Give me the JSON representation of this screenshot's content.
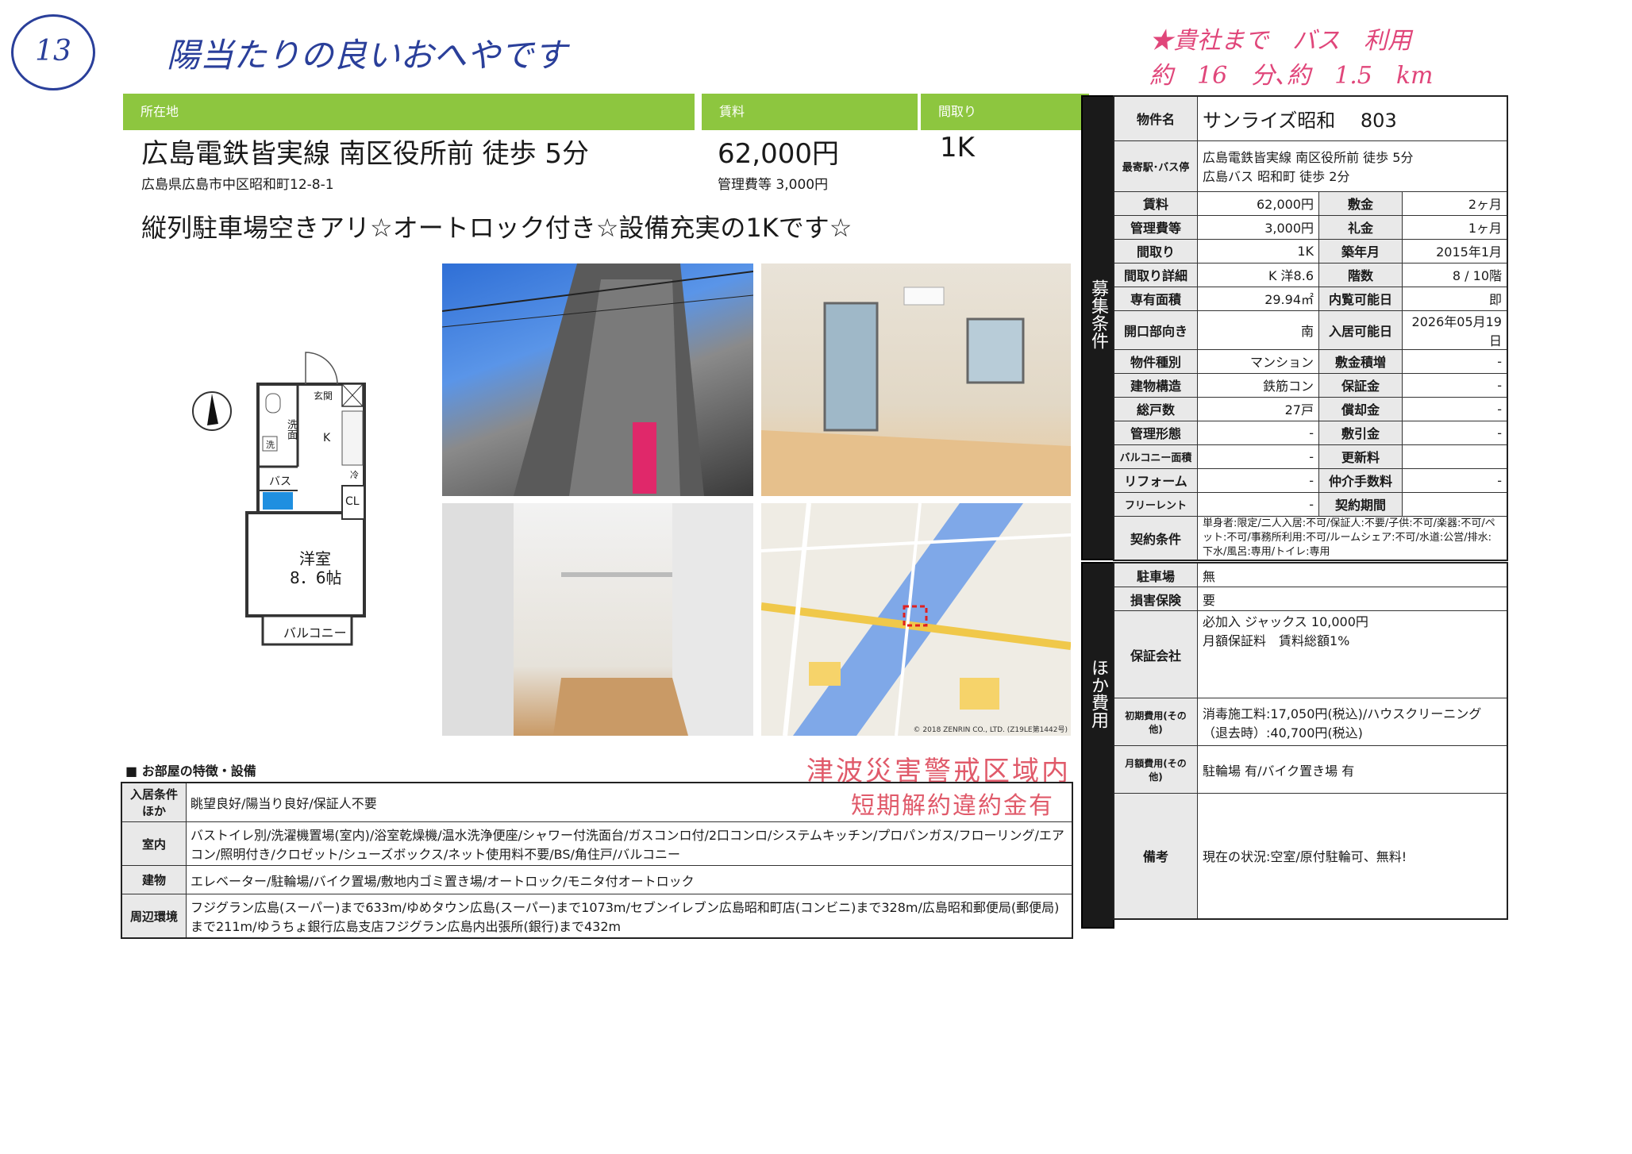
{
  "handwritten": {
    "circle_number": "13",
    "note_left": "陽当たりの良いおへやです",
    "note_right_line1": "★貴社まで　バス　利用",
    "note_right_line2": "約　16　分､約　1.5　km"
  },
  "header": {
    "location_label": "所在地",
    "rent_label": "賃料",
    "layout_label": "間取り",
    "access": "広島電鉄皆実線 南区役所前 徒歩 5分",
    "address": "広島県広島市中区昭和町12-8-1",
    "rent": "62,000円",
    "mgmt_fee": "管理費等 3,000円",
    "layout": "1K",
    "catchcopy": "縦列駐車場空きアリ☆オートロック付き☆設備充実の1Kです☆"
  },
  "floorplan": {
    "entrance": "玄関",
    "washroom": "洗面",
    "laundry": "洗",
    "kitchen": "K",
    "fridge": "冷",
    "bath": "バス",
    "closet": "CL",
    "room": "洋室",
    "room_size": "8．6帖",
    "balcony": "バルコニー"
  },
  "photos": {
    "map_copyright": "© 2018 ZENRIN CO., LTD. (Z19LE第1442号)"
  },
  "stamps": {
    "tsunami": "津波災害警戒区域内",
    "penalty": "短期解約違約金有"
  },
  "features": {
    "title": "■ お部屋の特徴・設備",
    "rows": [
      {
        "label": "入居条件ほか",
        "text": "眺望良好/陽当り良好/保証人不要"
      },
      {
        "label": "室内",
        "text": "バストイレ別/洗濯機置場(室内)/浴室乾燥機/温水洗浄便座/シャワー付洗面台/ガスコンロ付/2口コンロ/システムキッチン/プロパンガス/フローリング/エアコン/照明付き/クロゼット/シューズボックス/ネット使用料不要/BS/角住戸/バルコニー"
      },
      {
        "label": "建物",
        "text": "エレベーター/駐輪場/バイク置場/敷地内ゴミ置き場/オートロック/モニタ付オートロック"
      },
      {
        "label": "周辺環境",
        "text": "フジグラン広島(スーパー)まで633m/ゆめタウン広島(スーパー)まで1073m/セブンイレブン広島昭和町店(コンビニ)まで328m/広島昭和郵便局(郵便局)まで211m/ゆうちょ銀行広島支店フジグラン広島内出張所(銀行)まで432m"
      }
    ]
  },
  "spec": {
    "side_label_1": "募集条件",
    "side_label_2": "ほか費用",
    "name_label": "物件名",
    "name": "サンライズ昭和　 803",
    "station_label": "最寄駅･バス停",
    "station_1": "広島電鉄皆実線 南区役所前 徒歩 5分",
    "station_2": "広島バス 昭和町 徒歩 2分",
    "rows": [
      {
        "l1": "賃料",
        "v1": "62,000円",
        "l2": "敷金",
        "v2": "2ヶ月"
      },
      {
        "l1": "管理費等",
        "v1": "3,000円",
        "l2": "礼金",
        "v2": "1ヶ月"
      },
      {
        "l1": "間取り",
        "v1": "1K",
        "l2": "築年月",
        "v2": "2015年1月"
      },
      {
        "l1": "間取り詳細",
        "v1": "K 洋8.6",
        "l2": "階数",
        "v2": "8 / 10階"
      },
      {
        "l1": "専有面積",
        "v1": "29.94㎡",
        "l2": "内覧可能日",
        "v2": "即"
      },
      {
        "l1": "開口部向き",
        "v1": "南",
        "l2": "入居可能日",
        "v2": "2026年05月19日"
      },
      {
        "l1": "物件種別",
        "v1": "マンション",
        "l2": "敷金積増",
        "v2": "-"
      },
      {
        "l1": "建物構造",
        "v1": "鉄筋コン",
        "l2": "保証金",
        "v2": "-"
      },
      {
        "l1": "総戸数",
        "v1": "27戸",
        "l2": "償却金",
        "v2": "-"
      },
      {
        "l1": "管理形態",
        "v1": "-",
        "l2": "敷引金",
        "v2": "-"
      },
      {
        "l1": "バルコニー面積",
        "v1": "-",
        "l2": "更新料",
        "v2": ""
      },
      {
        "l1": "リフォーム",
        "v1": "-",
        "l2": "仲介手数料",
        "v2": "-"
      },
      {
        "l1": "フリーレント",
        "v1": "-",
        "l2": "契約期間",
        "v2": ""
      }
    ],
    "contract_label": "契約条件",
    "contract": "単身者:限定/二人入居:不可/保証人:不要/子供:不可/楽器:不可/ペット:不可/事務所利用:不可/ルームシェア:不可/水道:公営/排水:下水/風呂:専用/トイレ:専用",
    "parking_label": "駐車場",
    "parking": "無",
    "insurance_label": "損害保険",
    "insurance": "要",
    "guarantor_label": "保証会社",
    "guarantor_1": "必加入 ジャックス 10,000円",
    "guarantor_2": "月額保証料　賃料総額1%",
    "initial_label": "初期費用(その他)",
    "initial": "消毒施工料:17,050円(税込)/ハウスクリーニング（退去時）:40,700円(税込)",
    "monthly_label": "月額費用(その他)",
    "monthly": "駐輪場 有/バイク置き場 有",
    "remarks_label": "備考",
    "remarks": "現在の状況:空室/原付駐輪可、無料!"
  }
}
